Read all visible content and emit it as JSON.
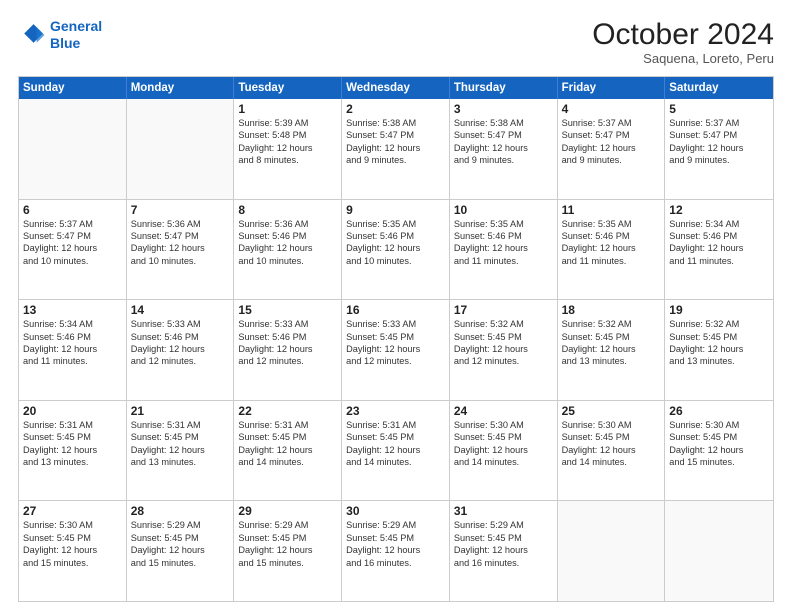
{
  "logo": {
    "line1": "General",
    "line2": "Blue"
  },
  "title": "October 2024",
  "subtitle": "Saquena, Loreto, Peru",
  "header_days": [
    "Sunday",
    "Monday",
    "Tuesday",
    "Wednesday",
    "Thursday",
    "Friday",
    "Saturday"
  ],
  "weeks": [
    [
      {
        "day": "",
        "info": "",
        "empty": true
      },
      {
        "day": "",
        "info": "",
        "empty": true
      },
      {
        "day": "1",
        "info": "Sunrise: 5:39 AM\nSunset: 5:48 PM\nDaylight: 12 hours\nand 8 minutes."
      },
      {
        "day": "2",
        "info": "Sunrise: 5:38 AM\nSunset: 5:47 PM\nDaylight: 12 hours\nand 9 minutes."
      },
      {
        "day": "3",
        "info": "Sunrise: 5:38 AM\nSunset: 5:47 PM\nDaylight: 12 hours\nand 9 minutes."
      },
      {
        "day": "4",
        "info": "Sunrise: 5:37 AM\nSunset: 5:47 PM\nDaylight: 12 hours\nand 9 minutes."
      },
      {
        "day": "5",
        "info": "Sunrise: 5:37 AM\nSunset: 5:47 PM\nDaylight: 12 hours\nand 9 minutes."
      }
    ],
    [
      {
        "day": "6",
        "info": "Sunrise: 5:37 AM\nSunset: 5:47 PM\nDaylight: 12 hours\nand 10 minutes."
      },
      {
        "day": "7",
        "info": "Sunrise: 5:36 AM\nSunset: 5:47 PM\nDaylight: 12 hours\nand 10 minutes."
      },
      {
        "day": "8",
        "info": "Sunrise: 5:36 AM\nSunset: 5:46 PM\nDaylight: 12 hours\nand 10 minutes."
      },
      {
        "day": "9",
        "info": "Sunrise: 5:35 AM\nSunset: 5:46 PM\nDaylight: 12 hours\nand 10 minutes."
      },
      {
        "day": "10",
        "info": "Sunrise: 5:35 AM\nSunset: 5:46 PM\nDaylight: 12 hours\nand 11 minutes."
      },
      {
        "day": "11",
        "info": "Sunrise: 5:35 AM\nSunset: 5:46 PM\nDaylight: 12 hours\nand 11 minutes."
      },
      {
        "day": "12",
        "info": "Sunrise: 5:34 AM\nSunset: 5:46 PM\nDaylight: 12 hours\nand 11 minutes."
      }
    ],
    [
      {
        "day": "13",
        "info": "Sunrise: 5:34 AM\nSunset: 5:46 PM\nDaylight: 12 hours\nand 11 minutes."
      },
      {
        "day": "14",
        "info": "Sunrise: 5:33 AM\nSunset: 5:46 PM\nDaylight: 12 hours\nand 12 minutes."
      },
      {
        "day": "15",
        "info": "Sunrise: 5:33 AM\nSunset: 5:46 PM\nDaylight: 12 hours\nand 12 minutes."
      },
      {
        "day": "16",
        "info": "Sunrise: 5:33 AM\nSunset: 5:45 PM\nDaylight: 12 hours\nand 12 minutes."
      },
      {
        "day": "17",
        "info": "Sunrise: 5:32 AM\nSunset: 5:45 PM\nDaylight: 12 hours\nand 12 minutes."
      },
      {
        "day": "18",
        "info": "Sunrise: 5:32 AM\nSunset: 5:45 PM\nDaylight: 12 hours\nand 13 minutes."
      },
      {
        "day": "19",
        "info": "Sunrise: 5:32 AM\nSunset: 5:45 PM\nDaylight: 12 hours\nand 13 minutes."
      }
    ],
    [
      {
        "day": "20",
        "info": "Sunrise: 5:31 AM\nSunset: 5:45 PM\nDaylight: 12 hours\nand 13 minutes."
      },
      {
        "day": "21",
        "info": "Sunrise: 5:31 AM\nSunset: 5:45 PM\nDaylight: 12 hours\nand 13 minutes."
      },
      {
        "day": "22",
        "info": "Sunrise: 5:31 AM\nSunset: 5:45 PM\nDaylight: 12 hours\nand 14 minutes."
      },
      {
        "day": "23",
        "info": "Sunrise: 5:31 AM\nSunset: 5:45 PM\nDaylight: 12 hours\nand 14 minutes."
      },
      {
        "day": "24",
        "info": "Sunrise: 5:30 AM\nSunset: 5:45 PM\nDaylight: 12 hours\nand 14 minutes."
      },
      {
        "day": "25",
        "info": "Sunrise: 5:30 AM\nSunset: 5:45 PM\nDaylight: 12 hours\nand 14 minutes."
      },
      {
        "day": "26",
        "info": "Sunrise: 5:30 AM\nSunset: 5:45 PM\nDaylight: 12 hours\nand 15 minutes."
      }
    ],
    [
      {
        "day": "27",
        "info": "Sunrise: 5:30 AM\nSunset: 5:45 PM\nDaylight: 12 hours\nand 15 minutes."
      },
      {
        "day": "28",
        "info": "Sunrise: 5:29 AM\nSunset: 5:45 PM\nDaylight: 12 hours\nand 15 minutes."
      },
      {
        "day": "29",
        "info": "Sunrise: 5:29 AM\nSunset: 5:45 PM\nDaylight: 12 hours\nand 15 minutes."
      },
      {
        "day": "30",
        "info": "Sunrise: 5:29 AM\nSunset: 5:45 PM\nDaylight: 12 hours\nand 16 minutes."
      },
      {
        "day": "31",
        "info": "Sunrise: 5:29 AM\nSunset: 5:45 PM\nDaylight: 12 hours\nand 16 minutes."
      },
      {
        "day": "",
        "info": "",
        "empty": true
      },
      {
        "day": "",
        "info": "",
        "empty": true
      }
    ]
  ]
}
